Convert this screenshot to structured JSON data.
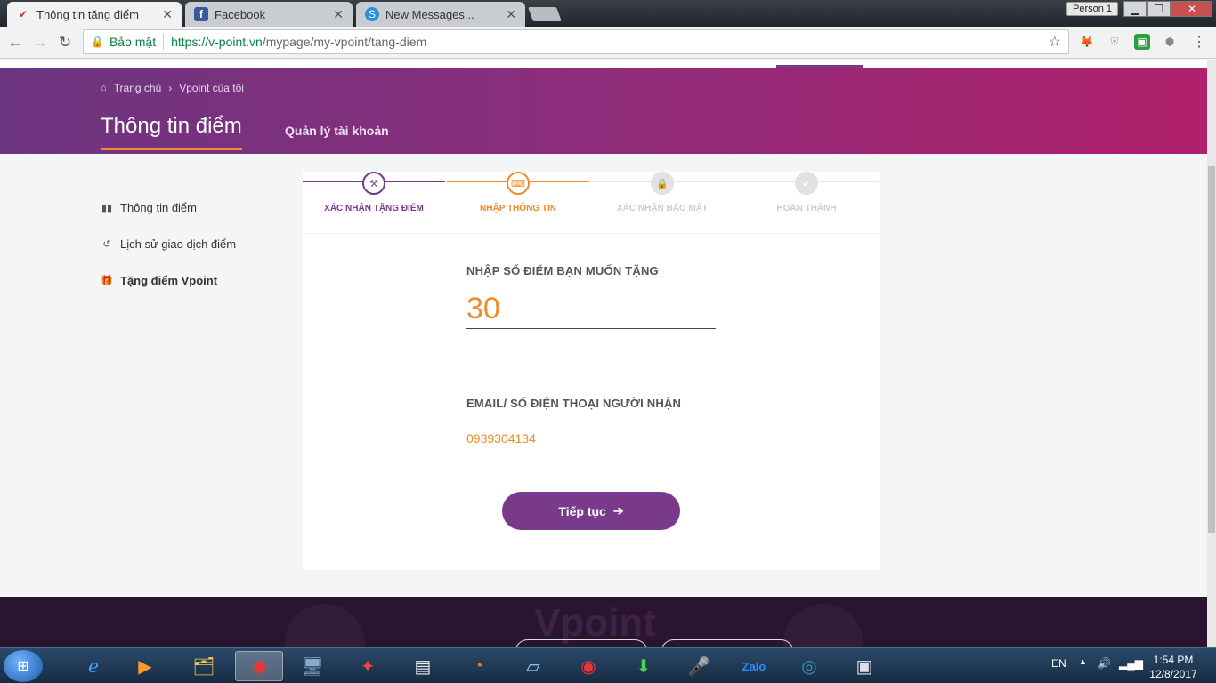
{
  "browser": {
    "tabs": [
      {
        "title": "Thông tin tặng điểm",
        "favicon": "vpoint-check-icon",
        "active": true
      },
      {
        "title": "Facebook",
        "favicon": "facebook-icon",
        "active": false
      },
      {
        "title": "New Messages...",
        "favicon": "skype-icon",
        "active": false
      }
    ],
    "profile": "Person 1",
    "secure_label": "Bảo mật",
    "url_scheme_host": "https://v-point.vn",
    "url_path": "/mypage/my-vpoint/tang-diem"
  },
  "breadcrumb": {
    "home": "Trang chủ",
    "current": "Vpoint của tôi"
  },
  "hero": {
    "title": "Thông tin điểm",
    "link": "Quản lý tài khoản"
  },
  "sidebar": {
    "items": [
      {
        "label": "Thông tin điểm",
        "icon": "bar-chart-icon"
      },
      {
        "label": "Lịch sử giao dịch điểm",
        "icon": "history-icon"
      },
      {
        "label": "Tặng điểm Vpoint",
        "icon": "gift-icon"
      }
    ]
  },
  "steps": [
    {
      "label": "XÁC NHẬN TẶNG ĐIỂM",
      "icon": "gavel-icon"
    },
    {
      "label": "NHẬP THÔNG TIN",
      "icon": "keyboard-icon"
    },
    {
      "label": "XÁC NHẬN BẢO MẬT",
      "icon": "lock-icon"
    },
    {
      "label": "HOÀN THÀNH",
      "icon": "check-icon"
    }
  ],
  "form": {
    "points_label": "NHẬP SỐ ĐIỂM BẠN MUỐN TẶNG",
    "points_value": "30",
    "recipient_label": "EMAIL/ SỐ ĐIỆN THOẠI NGƯỜI NHẬN",
    "recipient_value": "0939304134",
    "submit_label": "Tiếp tục"
  },
  "footer": {
    "brand": "Vpoint"
  },
  "taskbar": {
    "language": "EN",
    "time": "1:54 PM",
    "date": "12/8/2017"
  },
  "colors": {
    "purple": "#7a3a8c",
    "orange": "#f08a2a",
    "magenta": "#b0206b"
  }
}
